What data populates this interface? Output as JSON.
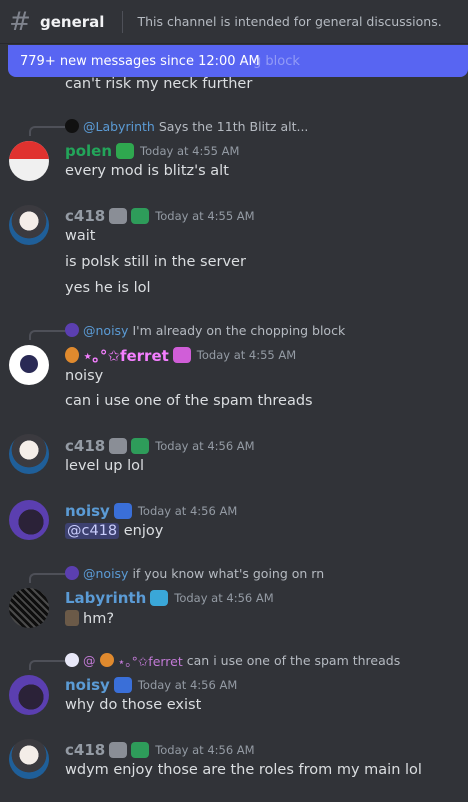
{
  "channel": {
    "name": "general",
    "topic": "This channel is intended for general discussions."
  },
  "banner": {
    "text": "779+ new messages since 12:00 AM",
    "ghost": "g block"
  },
  "colors": {
    "accent": "#5865f2",
    "polen": "#23a55a",
    "c418": "#949ba4",
    "ferret": "#f47fff",
    "noisy": "#5b9bd5",
    "labyrinth": "#5b9bd5"
  },
  "messages": [
    {
      "text": "can't risk my neck further"
    },
    {
      "reply": {
        "name": "@Labyrinth",
        "text": "Says the 11th Blitz alt..."
      },
      "author": "polen",
      "timestamp": "Today at 4:55 AM",
      "lines": [
        "every mod is blitz's alt"
      ]
    },
    {
      "author": "c418",
      "timestamp": "Today at 4:55 AM",
      "lines": [
        "wait",
        "is polsk still in the server",
        "yes he is lol"
      ]
    },
    {
      "reply": {
        "name": "@noisy",
        "text": "I'm already on the chopping block"
      },
      "author": "⋆｡°✩ferret",
      "timestamp": "Today at 4:55 AM",
      "lines": [
        "noisy",
        "can i use one of the spam threads"
      ]
    },
    {
      "author": "c418",
      "timestamp": "Today at 4:56 AM",
      "lines": [
        "level up lol"
      ]
    },
    {
      "author": "noisy",
      "timestamp": "Today at 4:56 AM",
      "mention": "@c418",
      "lines": [
        "enjoy"
      ]
    },
    {
      "reply": {
        "name": "@noisy",
        "text": "if you know what's going on rn"
      },
      "author": "Labyrinth",
      "timestamp": "Today at 4:56 AM",
      "lines": [
        "hm?"
      ]
    },
    {
      "reply": {
        "name": "@",
        "name2": "⋆｡°✩ferret",
        "text": "can i use one of the spam threads"
      },
      "author": "noisy",
      "timestamp": "Today at 4:56 AM",
      "lines": [
        "why do those exist"
      ]
    },
    {
      "author": "c418",
      "timestamp": "Today at 4:56 AM",
      "lines": [
        "wdym enjoy those are the roles from my main lol"
      ]
    }
  ]
}
